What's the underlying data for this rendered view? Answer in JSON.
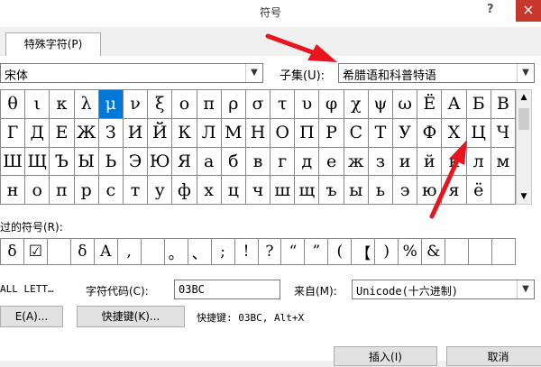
{
  "window": {
    "title": "符号",
    "help": "?",
    "close": "×"
  },
  "tabs": [
    {
      "label": "特殊字符(P)"
    }
  ],
  "font_combo": {
    "value": "宋体"
  },
  "subset": {
    "label": "子集(U):",
    "value": "希腊语和科普特语"
  },
  "symbols": [
    [
      "θ",
      "ι",
      "κ",
      "λ",
      "μ",
      "ν",
      "ξ",
      "ο",
      "π",
      "ρ",
      "σ",
      "τ",
      "υ",
      "φ",
      "χ",
      "ψ",
      "ω",
      "Ё",
      "А",
      "Б",
      "В"
    ],
    [
      "Г",
      "Д",
      "Е",
      "Ж",
      "З",
      "И",
      "Й",
      "К",
      "Л",
      "М",
      "Н",
      "О",
      "П",
      "Р",
      "С",
      "Т",
      "У",
      "Ф",
      "Х",
      "Ц",
      "Ч"
    ],
    [
      "Ш",
      "Щ",
      "Ъ",
      "Ы",
      "Ь",
      "Э",
      "Ю",
      "Я",
      "а",
      "б",
      "в",
      "г",
      "д",
      "е",
      "ж",
      "з",
      "и",
      "й",
      "к",
      "л",
      "м"
    ],
    [
      "н",
      "о",
      "п",
      "р",
      "с",
      "т",
      "у",
      "ф",
      "х",
      "ц",
      "ч",
      "ш",
      "щ",
      "ъ",
      "ы",
      "ь",
      "э",
      "ю",
      "я",
      "ё",
      ""
    ]
  ],
  "selected_symbol": "μ",
  "recent": {
    "label": "过的符号(R):",
    "items": [
      "δ",
      "☑",
      "",
      "δ",
      "Α",
      ",",
      "",
      "。",
      "、",
      ";",
      "!",
      "?",
      "“",
      "”",
      "(",
      "【",
      ")",
      "%",
      "&",
      "",
      "",
      ""
    ]
  },
  "char_name": "ALL LETT…",
  "char_code": {
    "label": "字符代码(C):",
    "value": "03BC"
  },
  "from": {
    "label": "来自(M):",
    "value": "Unicode(十六进制)"
  },
  "buttons": {
    "autocorrect": "E(A)...",
    "shortcut_key": "快捷键(K)...",
    "insert": "插入(I)",
    "cancel": "取消"
  },
  "shortcut_text": "快捷键: 03BC, Alt+X",
  "colors": {
    "accent": "#0078d7",
    "annotation": "#e8141e",
    "close": "#c7372c"
  }
}
